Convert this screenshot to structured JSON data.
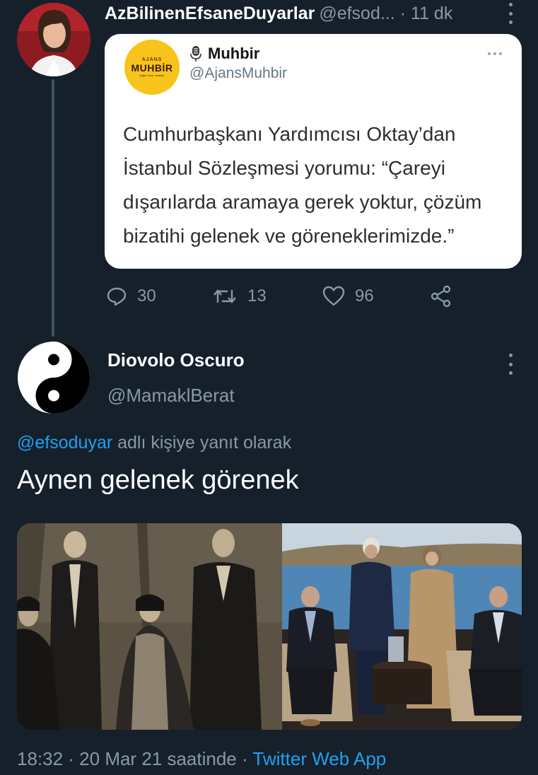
{
  "parent_tweet": {
    "display_name": "AzBilinenEfsaneDuyarlar",
    "handle": "@efsod...",
    "separator": "·",
    "time": "11 dk",
    "avatar_icon": "profile-photo",
    "quoted_card": {
      "logo_small": "AJANS",
      "logo_main": "MUHBİR",
      "logo_tagline": "doğru, hızlı, tarafsız",
      "name": "Muhbir",
      "handle": "@AjansMuhbir",
      "text": "Cumhurbaşkanı Yardımcısı Oktay’dan İstanbul Sözleşmesi yorumu: “Çareyi dışarılarda aramaya gerek yoktur, çözüm bizatihi gelenek ve göreneklerimizde.”"
    },
    "actions": {
      "replies": "30",
      "retweets": "13",
      "likes": "96"
    }
  },
  "reply_tweet": {
    "display_name": "Diovolo Oscuro",
    "handle": "@MamaklBerat",
    "avatar_icon": "yin-yang",
    "replying_to_mention": "@efsoduyar",
    "replying_to_suffix": "adlı kişiye yanıt olarak",
    "text": "Aynen gelenek görenek",
    "meta_time": "18:32 · 20 Mar 21 saatinde · ",
    "meta_app": "Twitter Web App"
  },
  "colors": {
    "background": "#15202b",
    "secondary_text": "#8899a6",
    "link": "#1da1f2",
    "thread_line": "#3d5466"
  }
}
